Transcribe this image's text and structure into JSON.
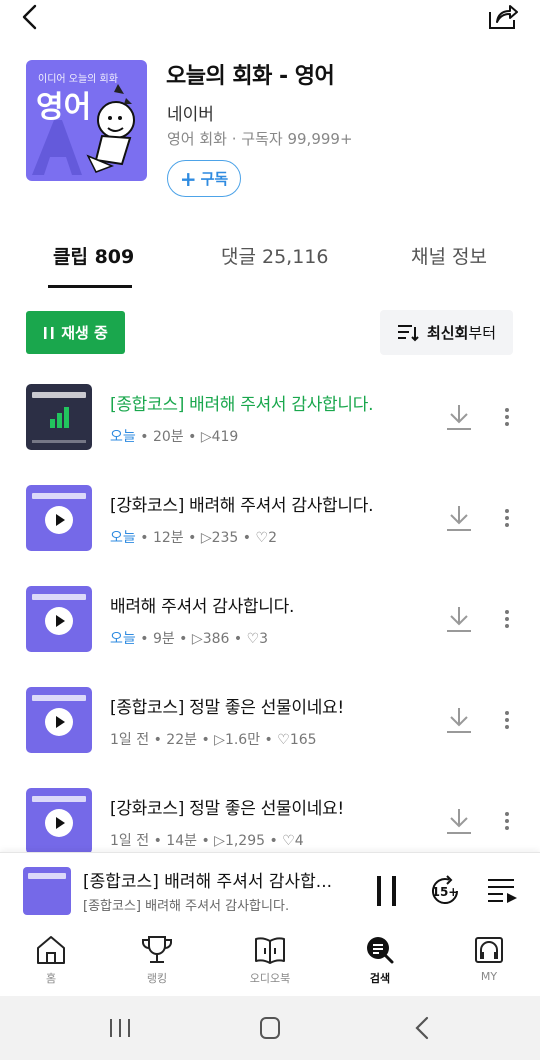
{
  "podcast": {
    "cover_small_text": "이디어 오늘의 회화",
    "cover_big_text": "영어",
    "title": "오늘의 회화 - 영어",
    "publisher": "네이버",
    "category": "영어 회화",
    "subscribers": "구독자 99,999+",
    "subscribe_label": "구독"
  },
  "tabs": [
    {
      "label": "클립 809",
      "active": true
    },
    {
      "label": "댓글 25,116",
      "active": false
    },
    {
      "label": "채널 정보",
      "active": false
    }
  ],
  "controls": {
    "playing_label": "재생 중",
    "sort_bold": "최신회",
    "sort_rest": "부터"
  },
  "clips": [
    {
      "title": "[종합코스] 배려해 주셔서 감사합니다.",
      "owner": "오늘",
      "age": "",
      "duration": "20분",
      "plays": "419",
      "likes": "",
      "playing": true
    },
    {
      "title": "[강화코스] 배려해 주셔서 감사합니다.",
      "owner": "오늘",
      "age": "",
      "duration": "12분",
      "plays": "235",
      "likes": "2",
      "playing": false
    },
    {
      "title": "배려해 주셔서 감사합니다.",
      "owner": "오늘",
      "age": "",
      "duration": "9분",
      "plays": "386",
      "likes": "3",
      "playing": false
    },
    {
      "title": "[종합코스] 정말 좋은 선물이네요!",
      "owner": "",
      "age": "1일 전",
      "duration": "22분",
      "plays": "1.6만",
      "likes": "165",
      "playing": false
    },
    {
      "title": "[강화코스] 정말 좋은 선물이네요!",
      "owner": "",
      "age": "1일 전",
      "duration": "14분",
      "plays": "1,295",
      "likes": "4",
      "playing": false
    }
  ],
  "mini_player": {
    "title": "[종합코스] 배려해 주셔서 감사합...",
    "subtitle": "[종합코스] 배려해 주셔서 감사합니다.",
    "skip_label": "15+"
  },
  "nav": [
    {
      "label": "홈",
      "icon": "home-icon",
      "active": false
    },
    {
      "label": "랭킹",
      "icon": "trophy-icon",
      "active": false
    },
    {
      "label": "오디오북",
      "icon": "audiobook-icon",
      "active": false
    },
    {
      "label": "검색",
      "icon": "search-icon",
      "active": true
    },
    {
      "label": "MY",
      "icon": "headphones-icon",
      "active": false
    }
  ],
  "colors": {
    "accent_green": "#1aa74d",
    "accent_blue": "#2f8be0",
    "cover_purple": "#7b6ff0"
  }
}
